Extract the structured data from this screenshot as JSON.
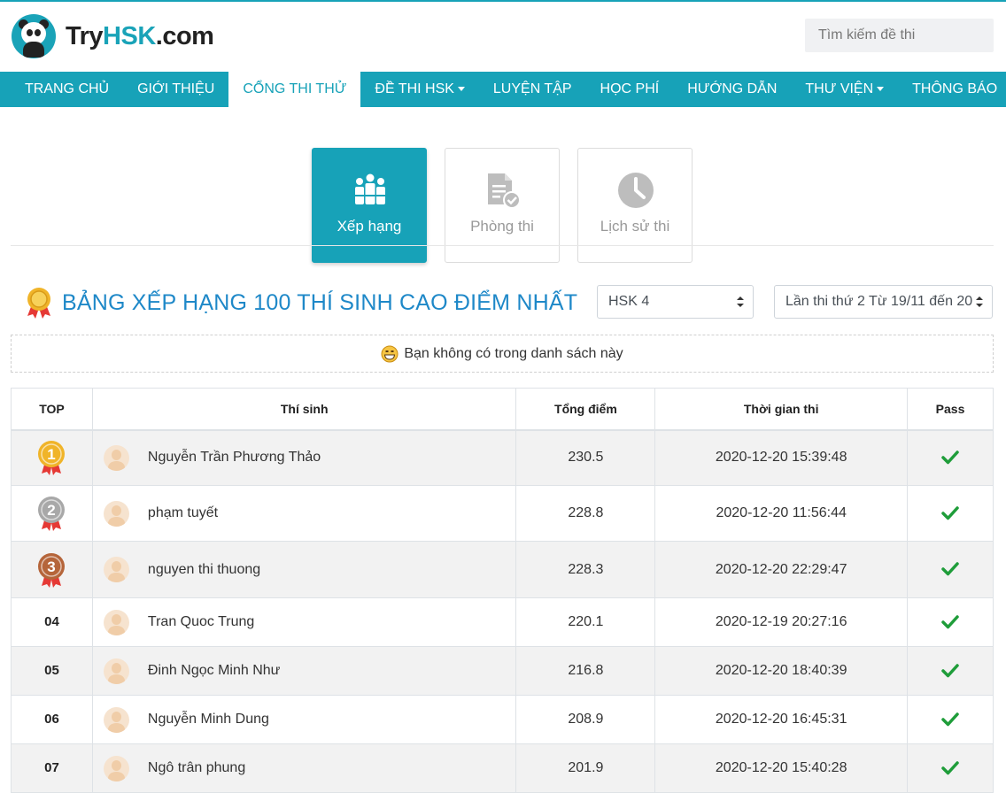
{
  "brand": {
    "text_a": "Try",
    "text_b": "HSK",
    "text_c": ".com",
    "accent": "#17a2b8"
  },
  "search": {
    "placeholder": "Tìm kiếm đề thi"
  },
  "nav": {
    "items": [
      {
        "label": "TRANG CHỦ"
      },
      {
        "label": "GIỚI THIỆU"
      },
      {
        "label": "CỔNG THI THỬ",
        "active": true
      },
      {
        "label": "ĐỀ THI HSK",
        "dropdown": true
      },
      {
        "label": "LUYỆN TẬP"
      },
      {
        "label": "HỌC PHÍ"
      },
      {
        "label": "HƯỚNG DẪN"
      },
      {
        "label": "THƯ VIỆN",
        "dropdown": true
      },
      {
        "label": "THÔNG BÁO"
      }
    ]
  },
  "tabs": [
    {
      "label": "Xếp hạng",
      "icon": "ranking-icon",
      "active": true
    },
    {
      "label": "Phòng thi",
      "icon": "exam-document-icon"
    },
    {
      "label": "Lịch sử thi",
      "icon": "clock-icon"
    }
  ],
  "ranking": {
    "title": "BẢNG XẾP HẠNG 100 THÍ SINH CAO ĐIỂM NHẤT",
    "level_select": "HSK 4",
    "round_select": "Lần thi thứ 2 Từ 19/11 đến 20",
    "notice": "Bạn không có trong danh sách này"
  },
  "table": {
    "headers": {
      "top": "TOP",
      "name": "Thí sinh",
      "score": "Tổng điểm",
      "time": "Thời gian thi",
      "pass": "Pass"
    },
    "rows": [
      {
        "rank": "1",
        "medal": "gold",
        "name": "Nguyễn Trần Phương Thảo",
        "score": "230.5",
        "time": "2020-12-20 15:39:48",
        "pass": true
      },
      {
        "rank": "2",
        "medal": "silver",
        "name": "phạm tuyết",
        "score": "228.8",
        "time": "2020-12-20 11:56:44",
        "pass": true
      },
      {
        "rank": "3",
        "medal": "bronze",
        "name": "nguyen thi thuong",
        "score": "228.3",
        "time": "2020-12-20 22:29:47",
        "pass": true
      },
      {
        "rank": "04",
        "name": "Tran Quoc Trung",
        "score": "220.1",
        "time": "2020-12-19 20:27:16",
        "pass": true
      },
      {
        "rank": "05",
        "name": "Đinh Ngọc Minh Như",
        "score": "216.8",
        "time": "2020-12-20 18:40:39",
        "pass": true
      },
      {
        "rank": "06",
        "name": "Nguyễn Minh Dung",
        "score": "208.9",
        "time": "2020-12-20 16:45:31",
        "pass": true
      },
      {
        "rank": "07",
        "name": "Ngô trân phung",
        "score": "201.9",
        "time": "2020-12-20 15:40:28",
        "pass": true
      }
    ]
  },
  "colors": {
    "gold": "#f0b429",
    "silver": "#a8a8a8",
    "bronze": "#b5653a",
    "check": "#1f9d3a",
    "title": "#1e88c8"
  }
}
